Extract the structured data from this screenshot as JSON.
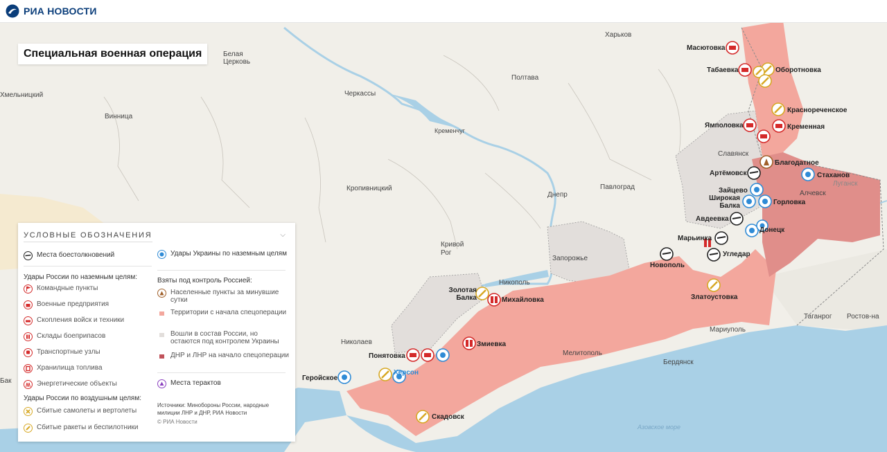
{
  "brand": {
    "name": "РИА НОВОСТИ"
  },
  "title": "Специальная военная операция",
  "colors": {
    "bg": "#f1efe9",
    "water": "#a9d0e6",
    "taken": "#f3a79d",
    "dnr_lnr": "#e08e8a",
    "contested": "#e2dedb",
    "strike_red": "#d42a2a",
    "strike_blue": "#2f8bd6",
    "air_yellow": "#d7a823"
  },
  "legend": {
    "heading": "УСЛОВНЫЕ ОБОЗНАЧЕНИЯ",
    "clash": "Места боестолкновений",
    "ukraine_strikes": "Удары Украины по наземным целям",
    "ground_heading": "Удары России по наземным целям:",
    "ground": [
      "Командные пункты",
      "Военные предприятия",
      "Скопления войск и техники",
      "Склады боеприпасов",
      "Транспортные узлы",
      "Хранилища топлива",
      "Энергетические объекты"
    ],
    "air_heading": "Удары России по воздушным целям:",
    "air": [
      "Сбитые самолеты и вертолеты",
      "Сбитые ракеты и беспилотники"
    ],
    "control_heading": "Взяты под контроль Россией:",
    "control": [
      "Населенные пункты за минувшие сутки",
      "Территории с начала спецоперации",
      "Вошли в состав России, но остаются под контролем Украины",
      "ДНР и ЛНР на начало спецоперации"
    ],
    "terror": "Места терактов",
    "sources": "Источники: Минобороны России, народные милиции ЛНР и ДНР, РИА Новости",
    "copyright": "© РИА Новости"
  },
  "cities": [
    "Харьков",
    "Полтава",
    "Черкассы",
    "Белая Церковь",
    "Винница",
    "Хмельницкий",
    "Кременчуг",
    "Кропивницкий",
    "Днепр",
    "Павлоград",
    "Кривой Рог",
    "Запорожье",
    "Никополь",
    "Николаев",
    "Мелитополь",
    "Бердянск",
    "Мариуполь",
    "Таганрог",
    "Ростов-на",
    "Алчевск",
    "Луганск",
    "Славянск",
    "Бак"
  ],
  "places": [
    "Масютовка",
    "Табаевка",
    "Оборотновка",
    "Краснореченское",
    "Ямполовка",
    "Кременная",
    "Благодатное",
    "Артёмовск",
    "Стаханов",
    "Зайцево",
    "Широкая Балка",
    "Горловка",
    "Авдеевка",
    "Донецк",
    "Марьинка",
    "Угледар",
    "Новополь",
    "Златоустовка",
    "Золотая Балка",
    "Михайловка",
    "Змиевка",
    "Понятовка",
    "Херсон",
    "Геройское",
    "Скадовск"
  ],
  "seas": [
    "Азовское море"
  ]
}
